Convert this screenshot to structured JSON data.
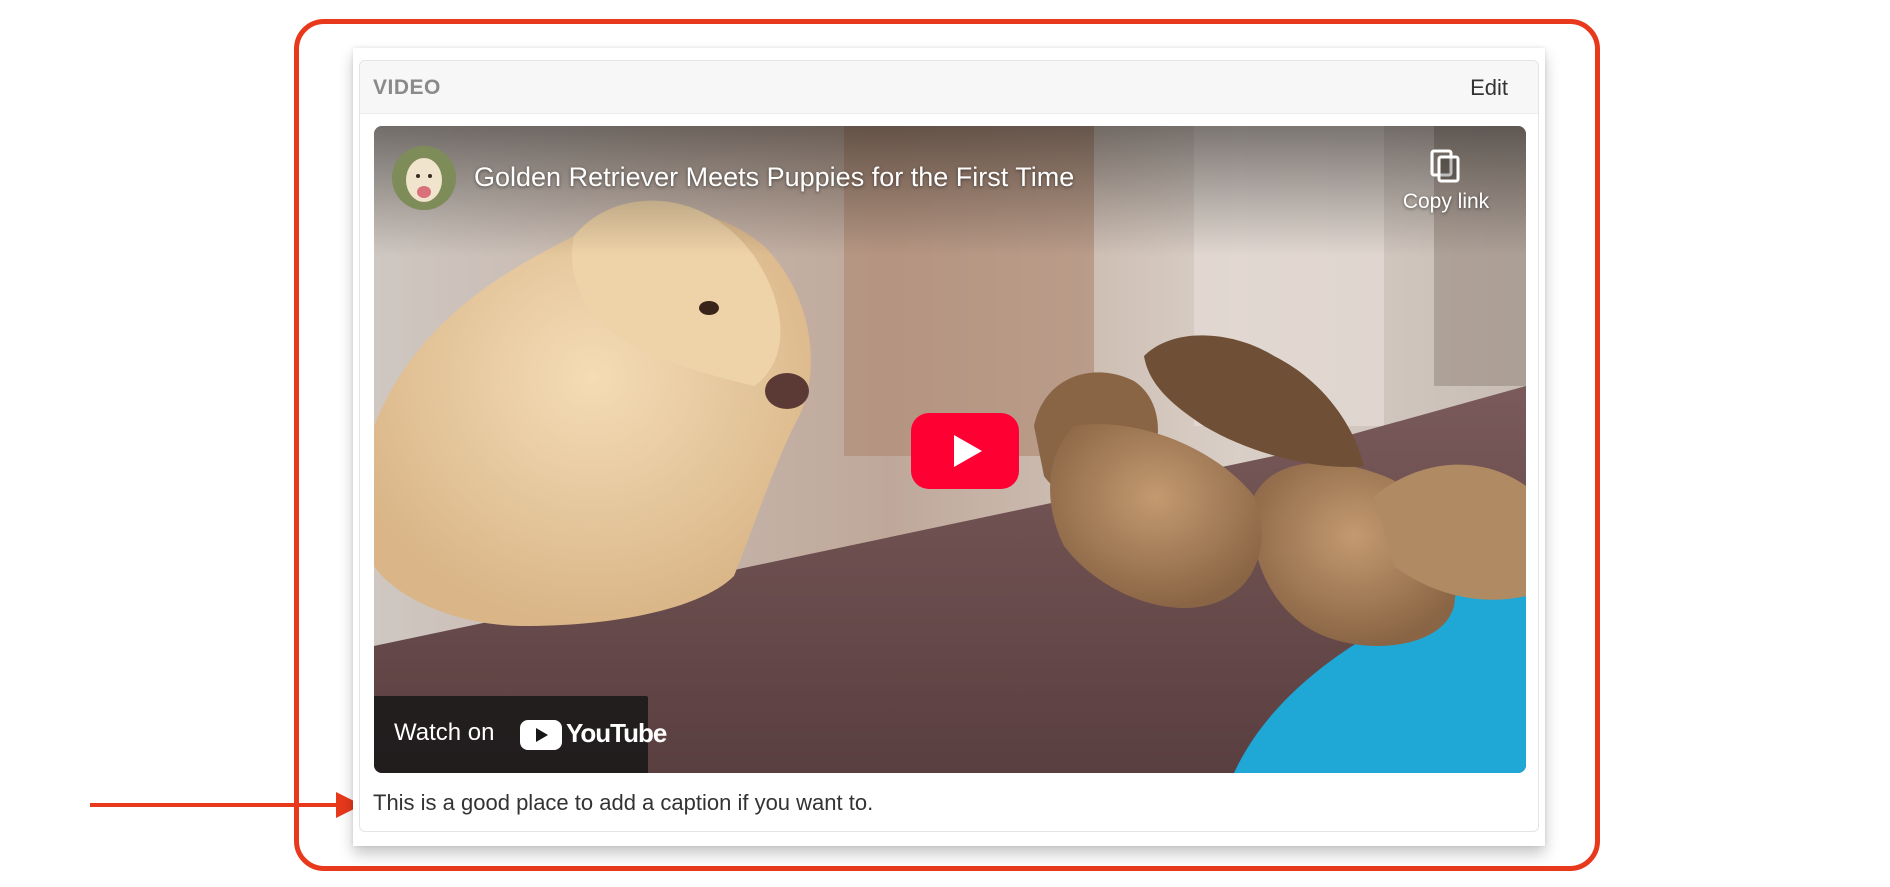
{
  "block": {
    "type_label": "VIDEO",
    "edit_label": "Edit",
    "caption": "This is a good place to add a caption if you want to."
  },
  "video": {
    "title": "Golden Retriever Meets Puppies for the First Time",
    "copy_link_label": "Copy link",
    "watch_on_label": "Watch on",
    "youtube_wordmark": "YouTube"
  },
  "colors": {
    "annotation": "#e8391c",
    "youtube_red": "#ff0033"
  }
}
